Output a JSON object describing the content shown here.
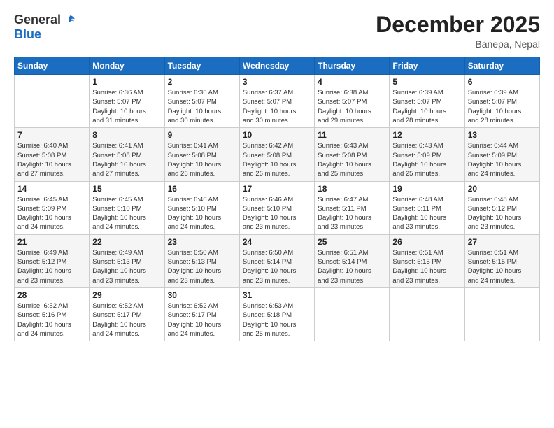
{
  "logo": {
    "general": "General",
    "blue": "Blue"
  },
  "title": "December 2025",
  "location": "Banepa, Nepal",
  "days_header": [
    "Sunday",
    "Monday",
    "Tuesday",
    "Wednesday",
    "Thursday",
    "Friday",
    "Saturday"
  ],
  "weeks": [
    [
      {
        "day": "",
        "info": ""
      },
      {
        "day": "1",
        "info": "Sunrise: 6:36 AM\nSunset: 5:07 PM\nDaylight: 10 hours\nand 31 minutes."
      },
      {
        "day": "2",
        "info": "Sunrise: 6:36 AM\nSunset: 5:07 PM\nDaylight: 10 hours\nand 30 minutes."
      },
      {
        "day": "3",
        "info": "Sunrise: 6:37 AM\nSunset: 5:07 PM\nDaylight: 10 hours\nand 30 minutes."
      },
      {
        "day": "4",
        "info": "Sunrise: 6:38 AM\nSunset: 5:07 PM\nDaylight: 10 hours\nand 29 minutes."
      },
      {
        "day": "5",
        "info": "Sunrise: 6:39 AM\nSunset: 5:07 PM\nDaylight: 10 hours\nand 28 minutes."
      },
      {
        "day": "6",
        "info": "Sunrise: 6:39 AM\nSunset: 5:07 PM\nDaylight: 10 hours\nand 28 minutes."
      }
    ],
    [
      {
        "day": "7",
        "info": "Sunrise: 6:40 AM\nSunset: 5:08 PM\nDaylight: 10 hours\nand 27 minutes."
      },
      {
        "day": "8",
        "info": "Sunrise: 6:41 AM\nSunset: 5:08 PM\nDaylight: 10 hours\nand 27 minutes."
      },
      {
        "day": "9",
        "info": "Sunrise: 6:41 AM\nSunset: 5:08 PM\nDaylight: 10 hours\nand 26 minutes."
      },
      {
        "day": "10",
        "info": "Sunrise: 6:42 AM\nSunset: 5:08 PM\nDaylight: 10 hours\nand 26 minutes."
      },
      {
        "day": "11",
        "info": "Sunrise: 6:43 AM\nSunset: 5:08 PM\nDaylight: 10 hours\nand 25 minutes."
      },
      {
        "day": "12",
        "info": "Sunrise: 6:43 AM\nSunset: 5:09 PM\nDaylight: 10 hours\nand 25 minutes."
      },
      {
        "day": "13",
        "info": "Sunrise: 6:44 AM\nSunset: 5:09 PM\nDaylight: 10 hours\nand 24 minutes."
      }
    ],
    [
      {
        "day": "14",
        "info": "Sunrise: 6:45 AM\nSunset: 5:09 PM\nDaylight: 10 hours\nand 24 minutes."
      },
      {
        "day": "15",
        "info": "Sunrise: 6:45 AM\nSunset: 5:10 PM\nDaylight: 10 hours\nand 24 minutes."
      },
      {
        "day": "16",
        "info": "Sunrise: 6:46 AM\nSunset: 5:10 PM\nDaylight: 10 hours\nand 24 minutes."
      },
      {
        "day": "17",
        "info": "Sunrise: 6:46 AM\nSunset: 5:10 PM\nDaylight: 10 hours\nand 23 minutes."
      },
      {
        "day": "18",
        "info": "Sunrise: 6:47 AM\nSunset: 5:11 PM\nDaylight: 10 hours\nand 23 minutes."
      },
      {
        "day": "19",
        "info": "Sunrise: 6:48 AM\nSunset: 5:11 PM\nDaylight: 10 hours\nand 23 minutes."
      },
      {
        "day": "20",
        "info": "Sunrise: 6:48 AM\nSunset: 5:12 PM\nDaylight: 10 hours\nand 23 minutes."
      }
    ],
    [
      {
        "day": "21",
        "info": "Sunrise: 6:49 AM\nSunset: 5:12 PM\nDaylight: 10 hours\nand 23 minutes."
      },
      {
        "day": "22",
        "info": "Sunrise: 6:49 AM\nSunset: 5:13 PM\nDaylight: 10 hours\nand 23 minutes."
      },
      {
        "day": "23",
        "info": "Sunrise: 6:50 AM\nSunset: 5:13 PM\nDaylight: 10 hours\nand 23 minutes."
      },
      {
        "day": "24",
        "info": "Sunrise: 6:50 AM\nSunset: 5:14 PM\nDaylight: 10 hours\nand 23 minutes."
      },
      {
        "day": "25",
        "info": "Sunrise: 6:51 AM\nSunset: 5:14 PM\nDaylight: 10 hours\nand 23 minutes."
      },
      {
        "day": "26",
        "info": "Sunrise: 6:51 AM\nSunset: 5:15 PM\nDaylight: 10 hours\nand 23 minutes."
      },
      {
        "day": "27",
        "info": "Sunrise: 6:51 AM\nSunset: 5:15 PM\nDaylight: 10 hours\nand 24 minutes."
      }
    ],
    [
      {
        "day": "28",
        "info": "Sunrise: 6:52 AM\nSunset: 5:16 PM\nDaylight: 10 hours\nand 24 minutes."
      },
      {
        "day": "29",
        "info": "Sunrise: 6:52 AM\nSunset: 5:17 PM\nDaylight: 10 hours\nand 24 minutes."
      },
      {
        "day": "30",
        "info": "Sunrise: 6:52 AM\nSunset: 5:17 PM\nDaylight: 10 hours\nand 24 minutes."
      },
      {
        "day": "31",
        "info": "Sunrise: 6:53 AM\nSunset: 5:18 PM\nDaylight: 10 hours\nand 25 minutes."
      },
      {
        "day": "",
        "info": ""
      },
      {
        "day": "",
        "info": ""
      },
      {
        "day": "",
        "info": ""
      }
    ]
  ]
}
